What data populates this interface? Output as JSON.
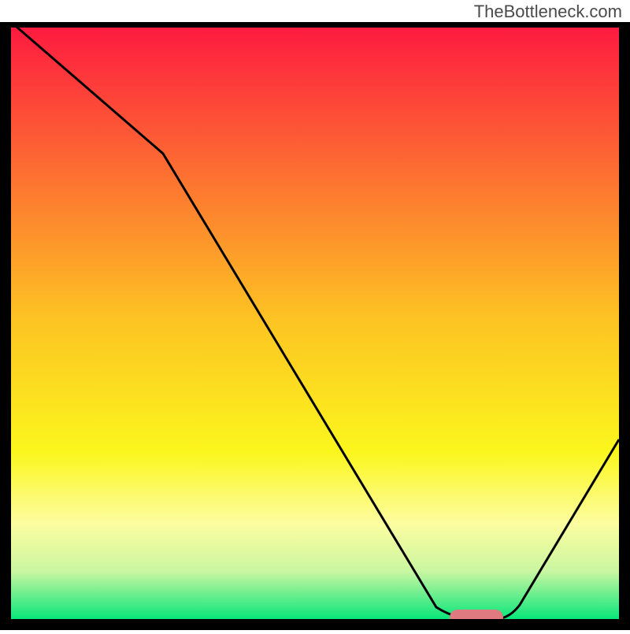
{
  "watermark": "TheBottleneck.com",
  "chart_data": {
    "type": "line",
    "title": "",
    "xlabel": "",
    "ylabel": "",
    "ylim": [
      0,
      100
    ],
    "xlim": [
      0,
      100
    ],
    "black_curve": {
      "x": [
        0,
        25,
        70,
        73,
        80,
        100
      ],
      "values": [
        100,
        78,
        2,
        0,
        0,
        30
      ]
    },
    "optimum_marker": {
      "x_start": 73,
      "x_end": 80,
      "color": "#df7a81"
    },
    "gradient_stops": [
      {
        "pct": 0,
        "color": "#fd1840"
      },
      {
        "pct": 50,
        "color": "#fdc423"
      },
      {
        "pct": 72,
        "color": "#fbf61d"
      },
      {
        "pct": 84,
        "color": "#fdfda0"
      },
      {
        "pct": 92,
        "color": "#caf6a1"
      },
      {
        "pct": 100,
        "color": "#09e67a"
      }
    ],
    "frame_border_color": "#000000"
  }
}
